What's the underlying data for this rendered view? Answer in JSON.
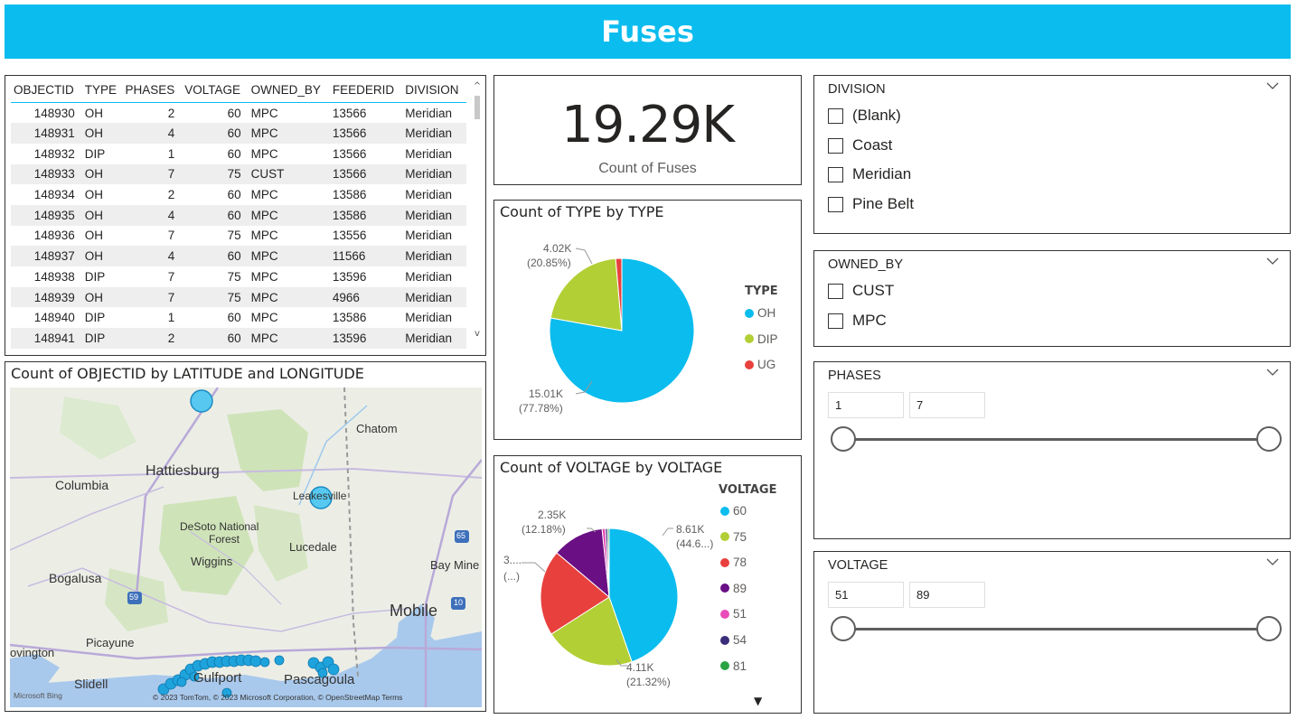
{
  "banner": {
    "title": "Fuses"
  },
  "table": {
    "columns": [
      "OBJECTID",
      "TYPE",
      "PHASES",
      "VOLTAGE",
      "OWNED_BY",
      "FEEDERID",
      "DIVISION"
    ],
    "rows": [
      [
        "148930",
        "OH",
        "2",
        "60",
        "MPC",
        "13566",
        "Meridian"
      ],
      [
        "148931",
        "OH",
        "4",
        "60",
        "MPC",
        "13566",
        "Meridian"
      ],
      [
        "148932",
        "DIP",
        "1",
        "60",
        "MPC",
        "13566",
        "Meridian"
      ],
      [
        "148933",
        "OH",
        "7",
        "75",
        "CUST",
        "13566",
        "Meridian"
      ],
      [
        "148934",
        "OH",
        "2",
        "60",
        "MPC",
        "13586",
        "Meridian"
      ],
      [
        "148935",
        "OH",
        "4",
        "60",
        "MPC",
        "13586",
        "Meridian"
      ],
      [
        "148936",
        "OH",
        "7",
        "75",
        "MPC",
        "13556",
        "Meridian"
      ],
      [
        "148937",
        "OH",
        "4",
        "60",
        "MPC",
        "11566",
        "Meridian"
      ],
      [
        "148938",
        "DIP",
        "7",
        "75",
        "MPC",
        "13596",
        "Meridian"
      ],
      [
        "148939",
        "OH",
        "7",
        "75",
        "MPC",
        "4966",
        "Meridian"
      ],
      [
        "148940",
        "DIP",
        "1",
        "60",
        "MPC",
        "13586",
        "Meridian"
      ],
      [
        "148941",
        "DIP",
        "2",
        "60",
        "MPC",
        "13596",
        "Meridian"
      ]
    ],
    "scroll_up": "^",
    "scroll_down": "v"
  },
  "kpi": {
    "value": "19.29K",
    "label": "Count of Fuses"
  },
  "map": {
    "title": "Count of OBJECTID by LATITUDE and LONGITUDE",
    "labels": {
      "chatom": "Chatom",
      "hattiesburg": "Hattiesburg",
      "columbia": "Columbia",
      "leakesville": "Leakesville",
      "desoto": "DeSoto National",
      "forest": "Forest",
      "lucedale": "Lucedale",
      "wiggins": "Wiggins",
      "bogalusa": "Bogalusa",
      "baymine": "Bay Mine",
      "mobile": "Mobile",
      "picayune": "Picayune",
      "ovington": "ovington",
      "slidell": "Slidell",
      "gulfport": "Gulfport",
      "pascagoula": "Pascagoula",
      "shield59": "59",
      "shield65": "65",
      "shield10": "10"
    },
    "attribution": "© 2023 TomTom, © 2023 Microsoft Corporation, © OpenStreetMap  Terms",
    "bing": "Microsoft Bing"
  },
  "type_chart": {
    "title": "Count of TYPE by TYPE",
    "legend_title": "TYPE",
    "labels": {
      "dip_value": "4.02K",
      "dip_pct": "(20.85%)",
      "oh_value": "15.01K",
      "oh_pct": "(77.78%)"
    },
    "chart_data": {
      "type": "pie",
      "title": "Count of TYPE by TYPE",
      "legend_title": "TYPE",
      "categories": [
        "OH",
        "DIP",
        "UG"
      ],
      "values": [
        15010,
        4020,
        264
      ],
      "colors": [
        "#0bbcee",
        "#b2cf35",
        "#e8413d"
      ]
    }
  },
  "voltage_chart": {
    "title": "Count of VOLTAGE by VOLTAGE",
    "legend_title": "VOLTAGE",
    "labels": {
      "v89_value": "2.35K",
      "v89_pct": "(12.18%)",
      "v60_value": "8.61K",
      "v60_pct": "(44.6...)",
      "v78_value": "3....",
      "v78_pct": "(...)",
      "v75_value": "4.11K",
      "v75_pct": "(21.32%)"
    },
    "more_icon": "▼",
    "chart_data": {
      "type": "pie",
      "title": "Count of VOLTAGE by VOLTAGE",
      "legend_title": "VOLTAGE",
      "categories": [
        "60",
        "75",
        "78",
        "89",
        "51",
        "54",
        "81"
      ],
      "values": [
        8610,
        4110,
        3900,
        2350,
        150,
        100,
        70
      ],
      "colors": [
        "#0bbcee",
        "#b2cf35",
        "#e8413d",
        "#6a0f84",
        "#e94cb8",
        "#3b2d7a",
        "#2aa444"
      ]
    }
  },
  "division_slicer": {
    "title": "DIVISION",
    "options": [
      "(Blank)",
      "Coast",
      "Meridian",
      "Pine Belt"
    ]
  },
  "owned_slicer": {
    "title": "OWNED_BY",
    "options": [
      "CUST",
      "MPC"
    ]
  },
  "phases_slicer": {
    "title": "PHASES",
    "min": "1",
    "max": "7"
  },
  "voltage_slicer": {
    "title": "VOLTAGE",
    "min": "51",
    "max": "89"
  },
  "icons": {
    "chevron": "chevron-down-icon"
  }
}
